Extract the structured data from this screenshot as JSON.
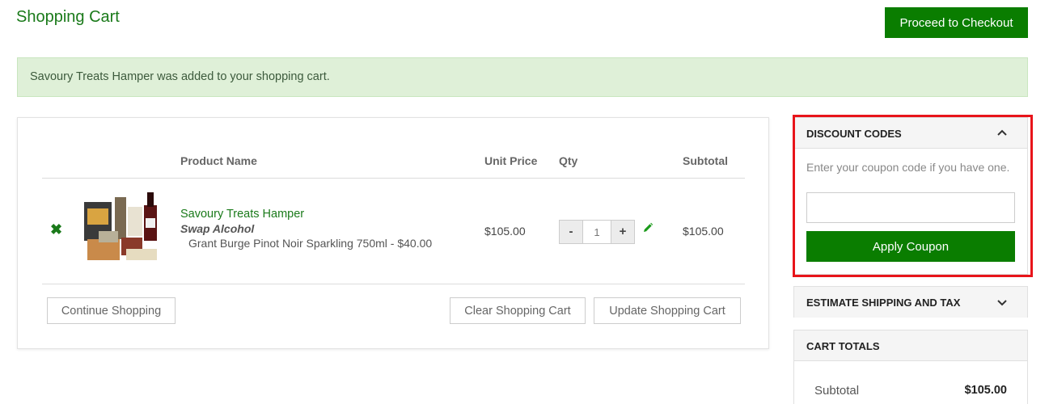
{
  "page": {
    "title": "Shopping Cart"
  },
  "header": {
    "checkout_label": "Proceed to Checkout"
  },
  "message": {
    "text": "Savoury Treats Hamper was added to your shopping cart."
  },
  "cart": {
    "columns": {
      "product": "Product Name",
      "unit_price": "Unit Price",
      "qty": "Qty",
      "subtotal": "Subtotal"
    },
    "items": [
      {
        "name": "Savoury Treats Hamper",
        "option_label": "Swap Alcohol",
        "option_value": "Grant Burge Pinot Noir Sparkling 750ml - $40.00",
        "unit_price": "$105.00",
        "qty": "1",
        "subtotal": "$105.00"
      }
    ],
    "qty_minus": "-",
    "qty_plus": "+",
    "continue_label": "Continue Shopping",
    "clear_label": "Clear Shopping Cart",
    "update_label": "Update Shopping Cart"
  },
  "discount": {
    "title": "DISCOUNT CODES",
    "help": "Enter your coupon code if you have one.",
    "input_value": "",
    "apply_label": "Apply Coupon",
    "expanded": true
  },
  "shipping": {
    "title": "ESTIMATE SHIPPING AND TAX",
    "expanded": false
  },
  "totals": {
    "title": "CART TOTALS",
    "subtotal_label": "Subtotal",
    "subtotal_value": "$105.00"
  },
  "colors": {
    "brand_green": "#0a7d00",
    "highlight_red": "#e8141a",
    "success_bg": "#dff0d8"
  },
  "icons": {
    "remove": "close-x-icon",
    "edit": "pencil-icon",
    "collapse": "chevron-up-icon",
    "expand": "chevron-down-icon"
  }
}
